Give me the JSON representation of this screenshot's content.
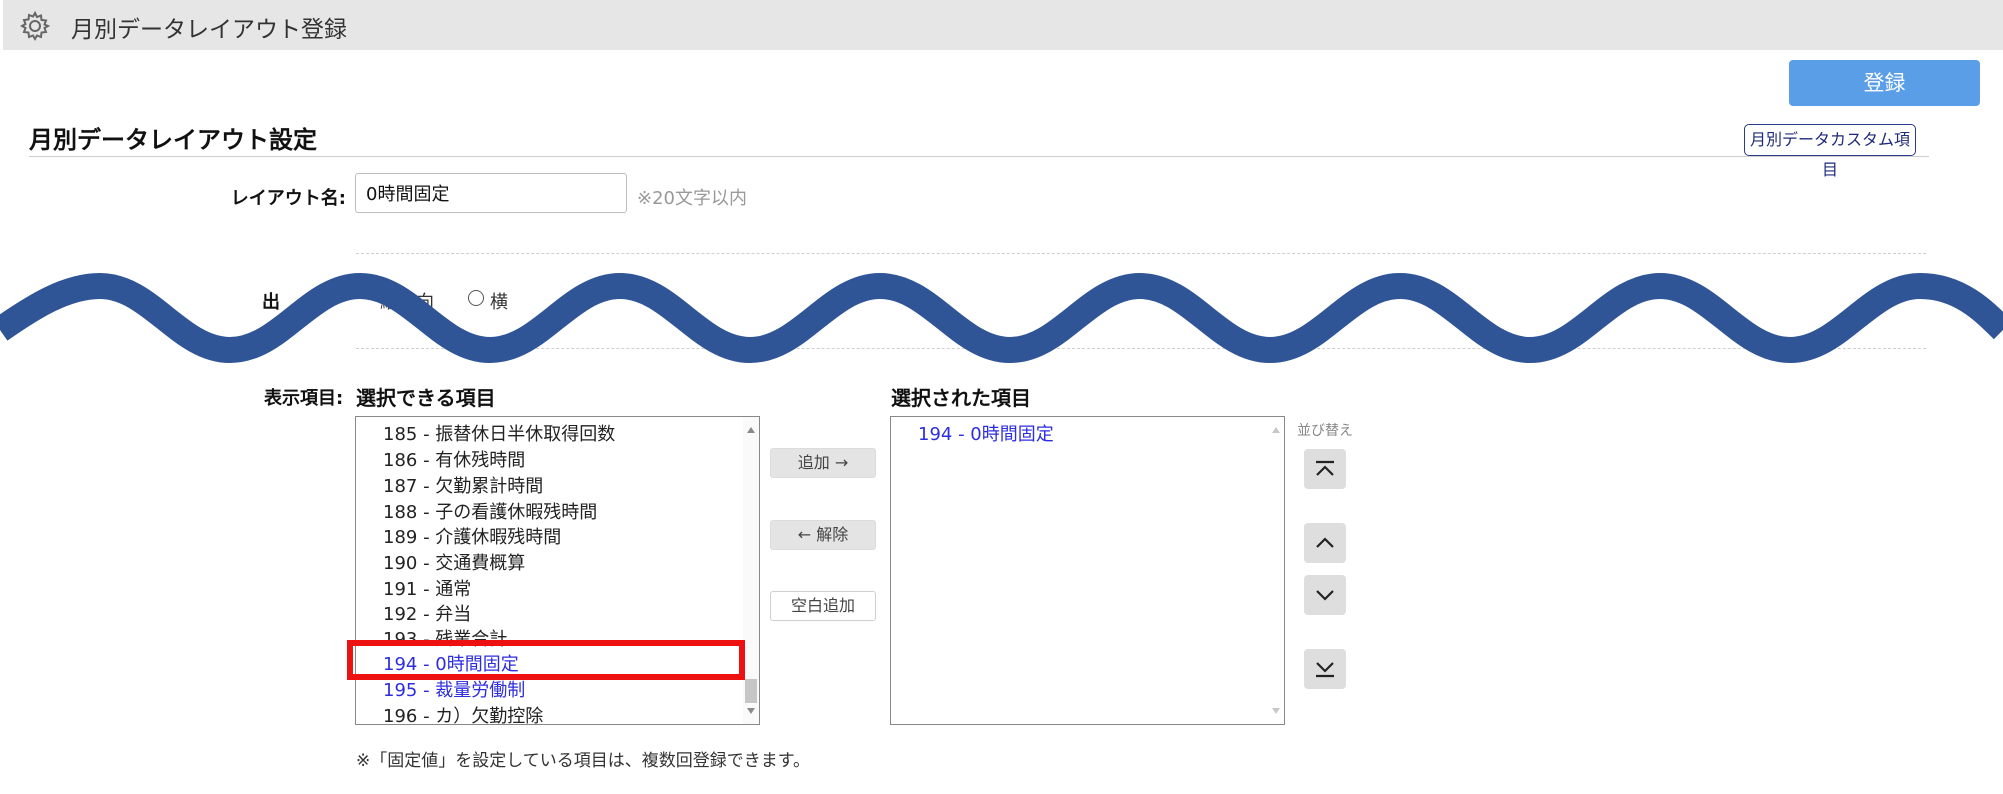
{
  "header": {
    "title": "月別データレイアウト登録",
    "icon": "gear-icon"
  },
  "toolbar": {
    "register_label": "登録"
  },
  "section": {
    "title": "月別データレイアウト設定",
    "custom_items_link": "月別データカスタム項目"
  },
  "layout_name": {
    "label": "レイアウト名:",
    "value": "0時間固定",
    "note": "※20文字以内"
  },
  "orientation": {
    "label_fragment": "出",
    "option_vertical": "縦方向",
    "option_horizontal_fragment": "横"
  },
  "display_items": {
    "label": "表示項目:",
    "available_header": "選択できる項目",
    "selected_header": "選択された項目",
    "available_items": [
      {
        "text": "185 - 振替休日半休取得回数",
        "color": "normal"
      },
      {
        "text": "186 - 有休残時間",
        "color": "normal"
      },
      {
        "text": "187 - 欠勤累計時間",
        "color": "normal"
      },
      {
        "text": "188 - 子の看護休暇残時間",
        "color": "normal"
      },
      {
        "text": "189 - 介護休暇残時間",
        "color": "normal"
      },
      {
        "text": "190 - 交通費概算",
        "color": "normal"
      },
      {
        "text": "191 - 通常",
        "color": "normal"
      },
      {
        "text": "192 - 弁当",
        "color": "normal"
      },
      {
        "text": "193 - 残業合計",
        "color": "normal"
      },
      {
        "text": "194 - 0時間固定",
        "color": "blue",
        "selected": true
      },
      {
        "text": "195 - 裁量労働制",
        "color": "blue"
      },
      {
        "text": "196 - カ）欠勤控除",
        "color": "normal"
      }
    ],
    "selected_items": [
      {
        "text": "194 - 0時間固定"
      }
    ],
    "add_label": "追加 →",
    "remove_label": "← 解除",
    "add_blank_label": "空白追加",
    "sort_label": "並び替え",
    "footnote": "※「固定値」を設定している項目は、複数回登録できます。"
  },
  "colors": {
    "accent": "#5b9ee8",
    "highlight": "#ee1111",
    "wave": "#2f5597",
    "link_text": "#2d2de0"
  }
}
